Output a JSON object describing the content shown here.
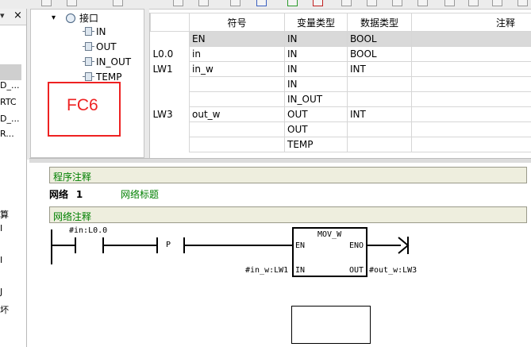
{
  "left_panel": {
    "items": [
      "D_...",
      "RTC",
      "D_...",
      "R...",
      "算",
      "I",
      "I",
      "J",
      "坏"
    ]
  },
  "tree": {
    "root_label": "接口",
    "items": [
      "IN",
      "OUT",
      "IN_OUT",
      "TEMP"
    ]
  },
  "annotation": {
    "text": "FC6",
    "color": "#e22222"
  },
  "var_table": {
    "headers": [
      "符号",
      "变量类型",
      "数据类型",
      "注释"
    ],
    "rows": [
      {
        "addr": "",
        "symbol": "EN",
        "var_type": "IN",
        "data_type": "BOOL",
        "comment": "",
        "highlight": true
      },
      {
        "addr": "L0.0",
        "symbol": "in",
        "var_type": "IN",
        "data_type": "BOOL",
        "comment": ""
      },
      {
        "addr": "LW1",
        "symbol": "in_w",
        "var_type": "IN",
        "data_type": "INT",
        "comment": ""
      },
      {
        "addr": "",
        "symbol": "",
        "var_type": "IN",
        "data_type": "",
        "comment": ""
      },
      {
        "addr": "",
        "symbol": "",
        "var_type": "IN_OUT",
        "data_type": "",
        "comment": ""
      },
      {
        "addr": "LW3",
        "symbol": "out_w",
        "var_type": "OUT",
        "data_type": "INT",
        "comment": ""
      },
      {
        "addr": "",
        "symbol": "",
        "var_type": "OUT",
        "data_type": "",
        "comment": ""
      },
      {
        "addr": "",
        "symbol": "",
        "var_type": "TEMP",
        "data_type": "",
        "comment": ""
      }
    ]
  },
  "editor": {
    "program_comment": "程序注释",
    "network_label": "网络",
    "network_number": "1",
    "network_title": "网络标题",
    "network_comment": "网络注释",
    "contact1_label": "#in:L0.0",
    "contact2_label": "P",
    "block_name": "MOV_W",
    "pin_en": "EN",
    "pin_eno": "ENO",
    "pin_in": "IN",
    "pin_out": "OUT",
    "in_operand": "#in_w:LW1",
    "out_operand": "#out_w:LW3"
  }
}
